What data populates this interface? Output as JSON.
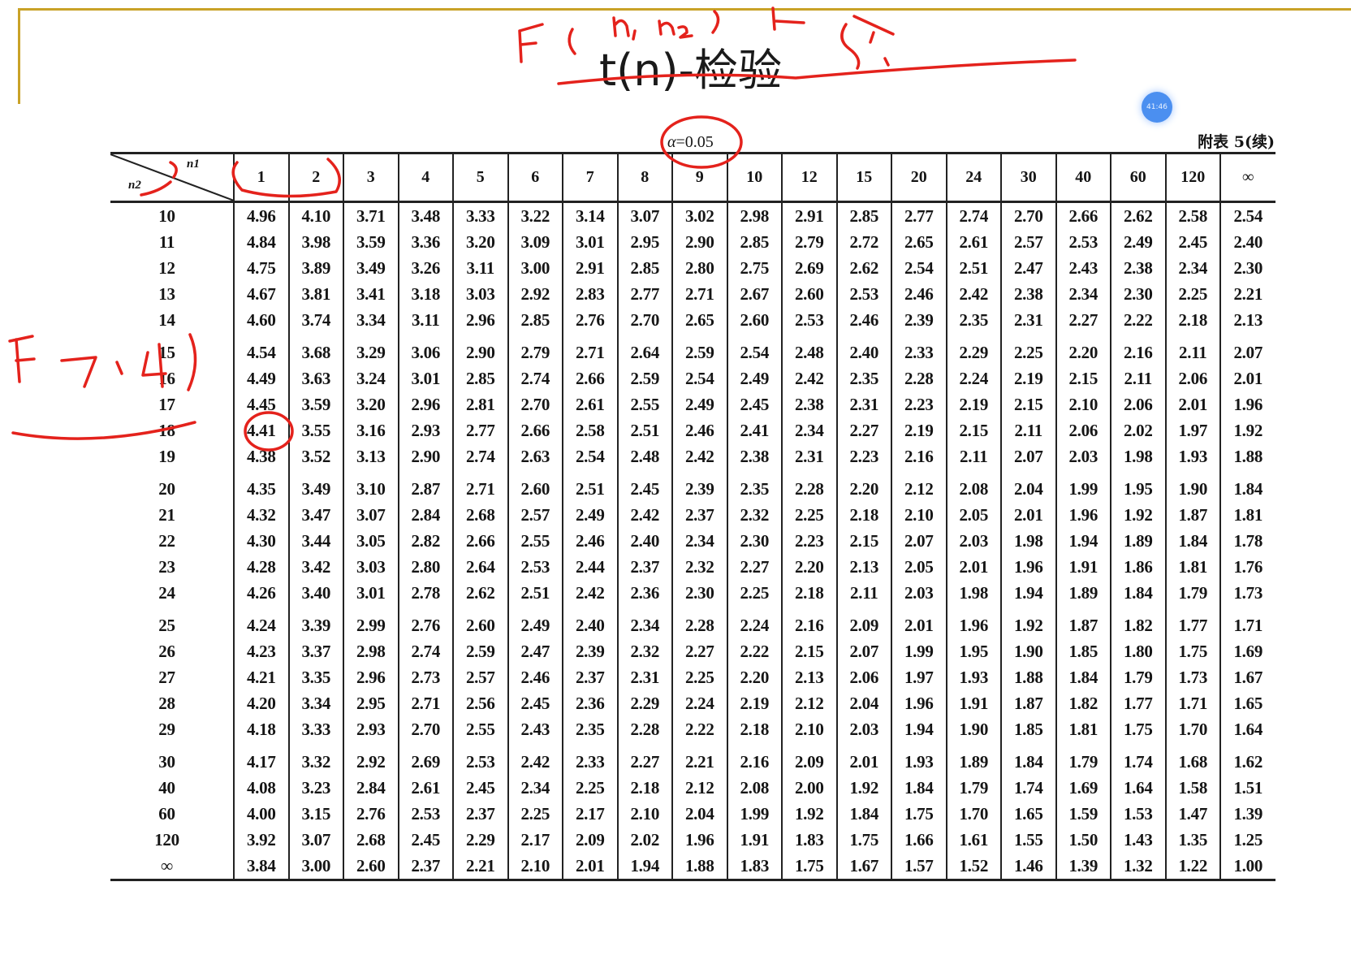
{
  "slide": {
    "title": "t(n)-检验",
    "timer": "41:46",
    "alpha_symbol": "α",
    "alpha_value": "=0.05",
    "appendix_label": "附表 5(续)"
  },
  "annotations": {
    "top_note": "F(n1,n2)",
    "top_note_2": "5%",
    "left_note": "F=7.4"
  },
  "table": {
    "corner_col_label": "n1",
    "corner_row_label": "n2",
    "columns": [
      "1",
      "2",
      "3",
      "4",
      "5",
      "6",
      "7",
      "8",
      "9",
      "10",
      "12",
      "15",
      "20",
      "24",
      "30",
      "40",
      "60",
      "120",
      "∞"
    ],
    "rows": [
      {
        "n2": "10",
        "values": [
          "4.96",
          "4.10",
          "3.71",
          "3.48",
          "3.33",
          "3.22",
          "3.14",
          "3.07",
          "3.02",
          "2.98",
          "2.91",
          "2.85",
          "2.77",
          "2.74",
          "2.70",
          "2.66",
          "2.62",
          "2.58",
          "2.54"
        ]
      },
      {
        "n2": "11",
        "values": [
          "4.84",
          "3.98",
          "3.59",
          "3.36",
          "3.20",
          "3.09",
          "3.01",
          "2.95",
          "2.90",
          "2.85",
          "2.79",
          "2.72",
          "2.65",
          "2.61",
          "2.57",
          "2.53",
          "2.49",
          "2.45",
          "2.40"
        ]
      },
      {
        "n2": "12",
        "values": [
          "4.75",
          "3.89",
          "3.49",
          "3.26",
          "3.11",
          "3.00",
          "2.91",
          "2.85",
          "2.80",
          "2.75",
          "2.69",
          "2.62",
          "2.54",
          "2.51",
          "2.47",
          "2.43",
          "2.38",
          "2.34",
          "2.30"
        ]
      },
      {
        "n2": "13",
        "values": [
          "4.67",
          "3.81",
          "3.41",
          "3.18",
          "3.03",
          "2.92",
          "2.83",
          "2.77",
          "2.71",
          "2.67",
          "2.60",
          "2.53",
          "2.46",
          "2.42",
          "2.38",
          "2.34",
          "2.30",
          "2.25",
          "2.21"
        ]
      },
      {
        "n2": "14",
        "values": [
          "4.60",
          "3.74",
          "3.34",
          "3.11",
          "2.96",
          "2.85",
          "2.76",
          "2.70",
          "2.65",
          "2.60",
          "2.53",
          "2.46",
          "2.39",
          "2.35",
          "2.31",
          "2.27",
          "2.22",
          "2.18",
          "2.13"
        ]
      },
      {
        "n2": "15",
        "values": [
          "4.54",
          "3.68",
          "3.29",
          "3.06",
          "2.90",
          "2.79",
          "2.71",
          "2.64",
          "2.59",
          "2.54",
          "2.48",
          "2.40",
          "2.33",
          "2.29",
          "2.25",
          "2.20",
          "2.16",
          "2.11",
          "2.07"
        ]
      },
      {
        "n2": "16",
        "values": [
          "4.49",
          "3.63",
          "3.24",
          "3.01",
          "2.85",
          "2.74",
          "2.66",
          "2.59",
          "2.54",
          "2.49",
          "2.42",
          "2.35",
          "2.28",
          "2.24",
          "2.19",
          "2.15",
          "2.11",
          "2.06",
          "2.01"
        ]
      },
      {
        "n2": "17",
        "values": [
          "4.45",
          "3.59",
          "3.20",
          "2.96",
          "2.81",
          "2.70",
          "2.61",
          "2.55",
          "2.49",
          "2.45",
          "2.38",
          "2.31",
          "2.23",
          "2.19",
          "2.15",
          "2.10",
          "2.06",
          "2.01",
          "1.96"
        ]
      },
      {
        "n2": "18",
        "values": [
          "4.41",
          "3.55",
          "3.16",
          "2.93",
          "2.77",
          "2.66",
          "2.58",
          "2.51",
          "2.46",
          "2.41",
          "2.34",
          "2.27",
          "2.19",
          "2.15",
          "2.11",
          "2.06",
          "2.02",
          "1.97",
          "1.92"
        ]
      },
      {
        "n2": "19",
        "values": [
          "4.38",
          "3.52",
          "3.13",
          "2.90",
          "2.74",
          "2.63",
          "2.54",
          "2.48",
          "2.42",
          "2.38",
          "2.31",
          "2.23",
          "2.16",
          "2.11",
          "2.07",
          "2.03",
          "1.98",
          "1.93",
          "1.88"
        ]
      },
      {
        "n2": "20",
        "values": [
          "4.35",
          "3.49",
          "3.10",
          "2.87",
          "2.71",
          "2.60",
          "2.51",
          "2.45",
          "2.39",
          "2.35",
          "2.28",
          "2.20",
          "2.12",
          "2.08",
          "2.04",
          "1.99",
          "1.95",
          "1.90",
          "1.84"
        ]
      },
      {
        "n2": "21",
        "values": [
          "4.32",
          "3.47",
          "3.07",
          "2.84",
          "2.68",
          "2.57",
          "2.49",
          "2.42",
          "2.37",
          "2.32",
          "2.25",
          "2.18",
          "2.10",
          "2.05",
          "2.01",
          "1.96",
          "1.92",
          "1.87",
          "1.81"
        ]
      },
      {
        "n2": "22",
        "values": [
          "4.30",
          "3.44",
          "3.05",
          "2.82",
          "2.66",
          "2.55",
          "2.46",
          "2.40",
          "2.34",
          "2.30",
          "2.23",
          "2.15",
          "2.07",
          "2.03",
          "1.98",
          "1.94",
          "1.89",
          "1.84",
          "1.78"
        ]
      },
      {
        "n2": "23",
        "values": [
          "4.28",
          "3.42",
          "3.03",
          "2.80",
          "2.64",
          "2.53",
          "2.44",
          "2.37",
          "2.32",
          "2.27",
          "2.20",
          "2.13",
          "2.05",
          "2.01",
          "1.96",
          "1.91",
          "1.86",
          "1.81",
          "1.76"
        ]
      },
      {
        "n2": "24",
        "values": [
          "4.26",
          "3.40",
          "3.01",
          "2.78",
          "2.62",
          "2.51",
          "2.42",
          "2.36",
          "2.30",
          "2.25",
          "2.18",
          "2.11",
          "2.03",
          "1.98",
          "1.94",
          "1.89",
          "1.84",
          "1.79",
          "1.73"
        ]
      },
      {
        "n2": "25",
        "values": [
          "4.24",
          "3.39",
          "2.99",
          "2.76",
          "2.60",
          "2.49",
          "2.40",
          "2.34",
          "2.28",
          "2.24",
          "2.16",
          "2.09",
          "2.01",
          "1.96",
          "1.92",
          "1.87",
          "1.82",
          "1.77",
          "1.71"
        ]
      },
      {
        "n2": "26",
        "values": [
          "4.23",
          "3.37",
          "2.98",
          "2.74",
          "2.59",
          "2.47",
          "2.39",
          "2.32",
          "2.27",
          "2.22",
          "2.15",
          "2.07",
          "1.99",
          "1.95",
          "1.90",
          "1.85",
          "1.80",
          "1.75",
          "1.69"
        ]
      },
      {
        "n2": "27",
        "values": [
          "4.21",
          "3.35",
          "2.96",
          "2.73",
          "2.57",
          "2.46",
          "2.37",
          "2.31",
          "2.25",
          "2.20",
          "2.13",
          "2.06",
          "1.97",
          "1.93",
          "1.88",
          "1.84",
          "1.79",
          "1.73",
          "1.67"
        ]
      },
      {
        "n2": "28",
        "values": [
          "4.20",
          "3.34",
          "2.95",
          "2.71",
          "2.56",
          "2.45",
          "2.36",
          "2.29",
          "2.24",
          "2.19",
          "2.12",
          "2.04",
          "1.96",
          "1.91",
          "1.87",
          "1.82",
          "1.77",
          "1.71",
          "1.65"
        ]
      },
      {
        "n2": "29",
        "values": [
          "4.18",
          "3.33",
          "2.93",
          "2.70",
          "2.55",
          "2.43",
          "2.35",
          "2.28",
          "2.22",
          "2.18",
          "2.10",
          "2.03",
          "1.94",
          "1.90",
          "1.85",
          "1.81",
          "1.75",
          "1.70",
          "1.64"
        ]
      },
      {
        "n2": "30",
        "values": [
          "4.17",
          "3.32",
          "2.92",
          "2.69",
          "2.53",
          "2.42",
          "2.33",
          "2.27",
          "2.21",
          "2.16",
          "2.09",
          "2.01",
          "1.93",
          "1.89",
          "1.84",
          "1.79",
          "1.74",
          "1.68",
          "1.62"
        ]
      },
      {
        "n2": "40",
        "values": [
          "4.08",
          "3.23",
          "2.84",
          "2.61",
          "2.45",
          "2.34",
          "2.25",
          "2.18",
          "2.12",
          "2.08",
          "2.00",
          "1.92",
          "1.84",
          "1.79",
          "1.74",
          "1.69",
          "1.64",
          "1.58",
          "1.51"
        ]
      },
      {
        "n2": "60",
        "values": [
          "4.00",
          "3.15",
          "2.76",
          "2.53",
          "2.37",
          "2.25",
          "2.17",
          "2.10",
          "2.04",
          "1.99",
          "1.92",
          "1.84",
          "1.75",
          "1.70",
          "1.65",
          "1.59",
          "1.53",
          "1.47",
          "1.39"
        ]
      },
      {
        "n2": "120",
        "values": [
          "3.92",
          "3.07",
          "2.68",
          "2.45",
          "2.29",
          "2.17",
          "2.09",
          "2.02",
          "1.96",
          "1.91",
          "1.83",
          "1.75",
          "1.66",
          "1.61",
          "1.55",
          "1.50",
          "1.43",
          "1.35",
          "1.25"
        ]
      },
      {
        "n2": "∞",
        "values": [
          "3.84",
          "3.00",
          "2.60",
          "2.37",
          "2.21",
          "2.10",
          "2.01",
          "1.94",
          "1.88",
          "1.83",
          "1.75",
          "1.67",
          "1.57",
          "1.52",
          "1.46",
          "1.39",
          "1.32",
          "1.22",
          "1.00"
        ]
      }
    ]
  },
  "colors": {
    "frame_accent": "#c9a227",
    "annotation_ink": "#e4221c",
    "timer_badge": "#4b8ff0"
  }
}
